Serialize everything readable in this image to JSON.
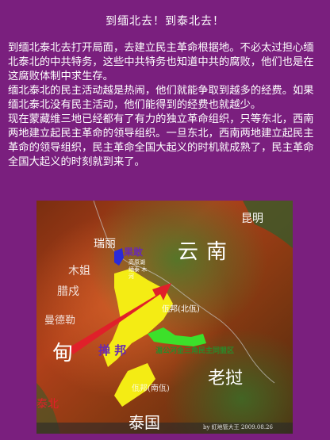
{
  "page": {
    "title": "到缅北去！到泰北去！",
    "paragraphs": [
      "到缅北泰北去打开局面，去建立民主革命根据地。不必太过担心缅北泰北的中共特务，这些中共特务也知道中共的腐败，他们也是在这腐败体制中求生存。",
      "缅北泰北的民主活动越是热闹，他们就能争取到越多的经费。如果缅北泰北没有民主活动，他们能得到的经费也就越少。",
      "现在蒙藏维三地已经都有了有力的独立革命组织，只等东北，西南两地建立起民主革命的领导组织。一旦东北，西南两地建立起民主革命的领导组织，民主革命全国大起义的时机就成熟了，民主革命全国大起义的时刻就到来了。"
    ]
  },
  "map": {
    "labels": {
      "kunming": "昆明",
      "yunnan": "云南",
      "ruili": "瑞丽",
      "guogan": "果敢",
      "muze": "木姐",
      "lashio": "腊戍",
      "mandalay": "曼德勒",
      "myanmar": "甸",
      "shan": "掸 邦",
      "wa": "佤邦(北佤)",
      "wa_south": "佤邦(南佤)",
      "laos": "老挝",
      "thailand": "泰国",
      "golden_triangle_note": "湄公河金三角民主同盟区",
      "small_note": "高原湖 缅泰 木河",
      "bottom_left": "泰北",
      "watermark": "by 紅地管大王 2009.08.26"
    },
    "colors": {
      "region_yellow": "#f4ec14",
      "region_green": "#3ce02a",
      "region_blue": "#2a2ad8",
      "arrow_red": "#e0202a",
      "label_purple": "#6a2ab0"
    }
  }
}
